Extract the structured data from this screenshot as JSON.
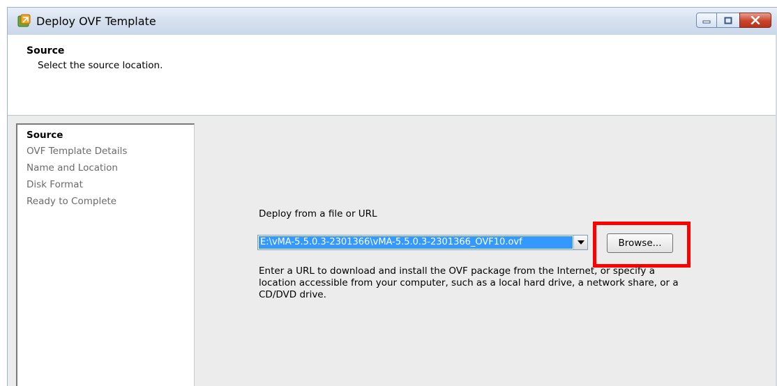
{
  "window": {
    "title": "Deploy OVF Template",
    "buttons": [
      "minimize",
      "maximize",
      "close"
    ]
  },
  "header": {
    "title": "Source",
    "subtitle": "Select the source location."
  },
  "steps": [
    {
      "label": "Source",
      "active": true
    },
    {
      "label": "OVF Template Details",
      "active": false
    },
    {
      "label": "Name and Location",
      "active": false
    },
    {
      "label": "Disk Format",
      "active": false
    },
    {
      "label": "Ready to Complete",
      "active": false
    }
  ],
  "source": {
    "label": "Deploy from a file or URL",
    "value": "E:\\vMA-5.5.0.3-2301366\\vMA-5.5.0.3-2301366_OVF10.ovf",
    "browse_label": "Browse...",
    "help": "Enter a URL to download and install the OVF package from the Internet, or specify a location accessible from your computer, such as a local hard drive, a network share, or a CD/DVD drive."
  },
  "colors": {
    "highlight": "#ff0000",
    "selection": "#3399ff"
  }
}
